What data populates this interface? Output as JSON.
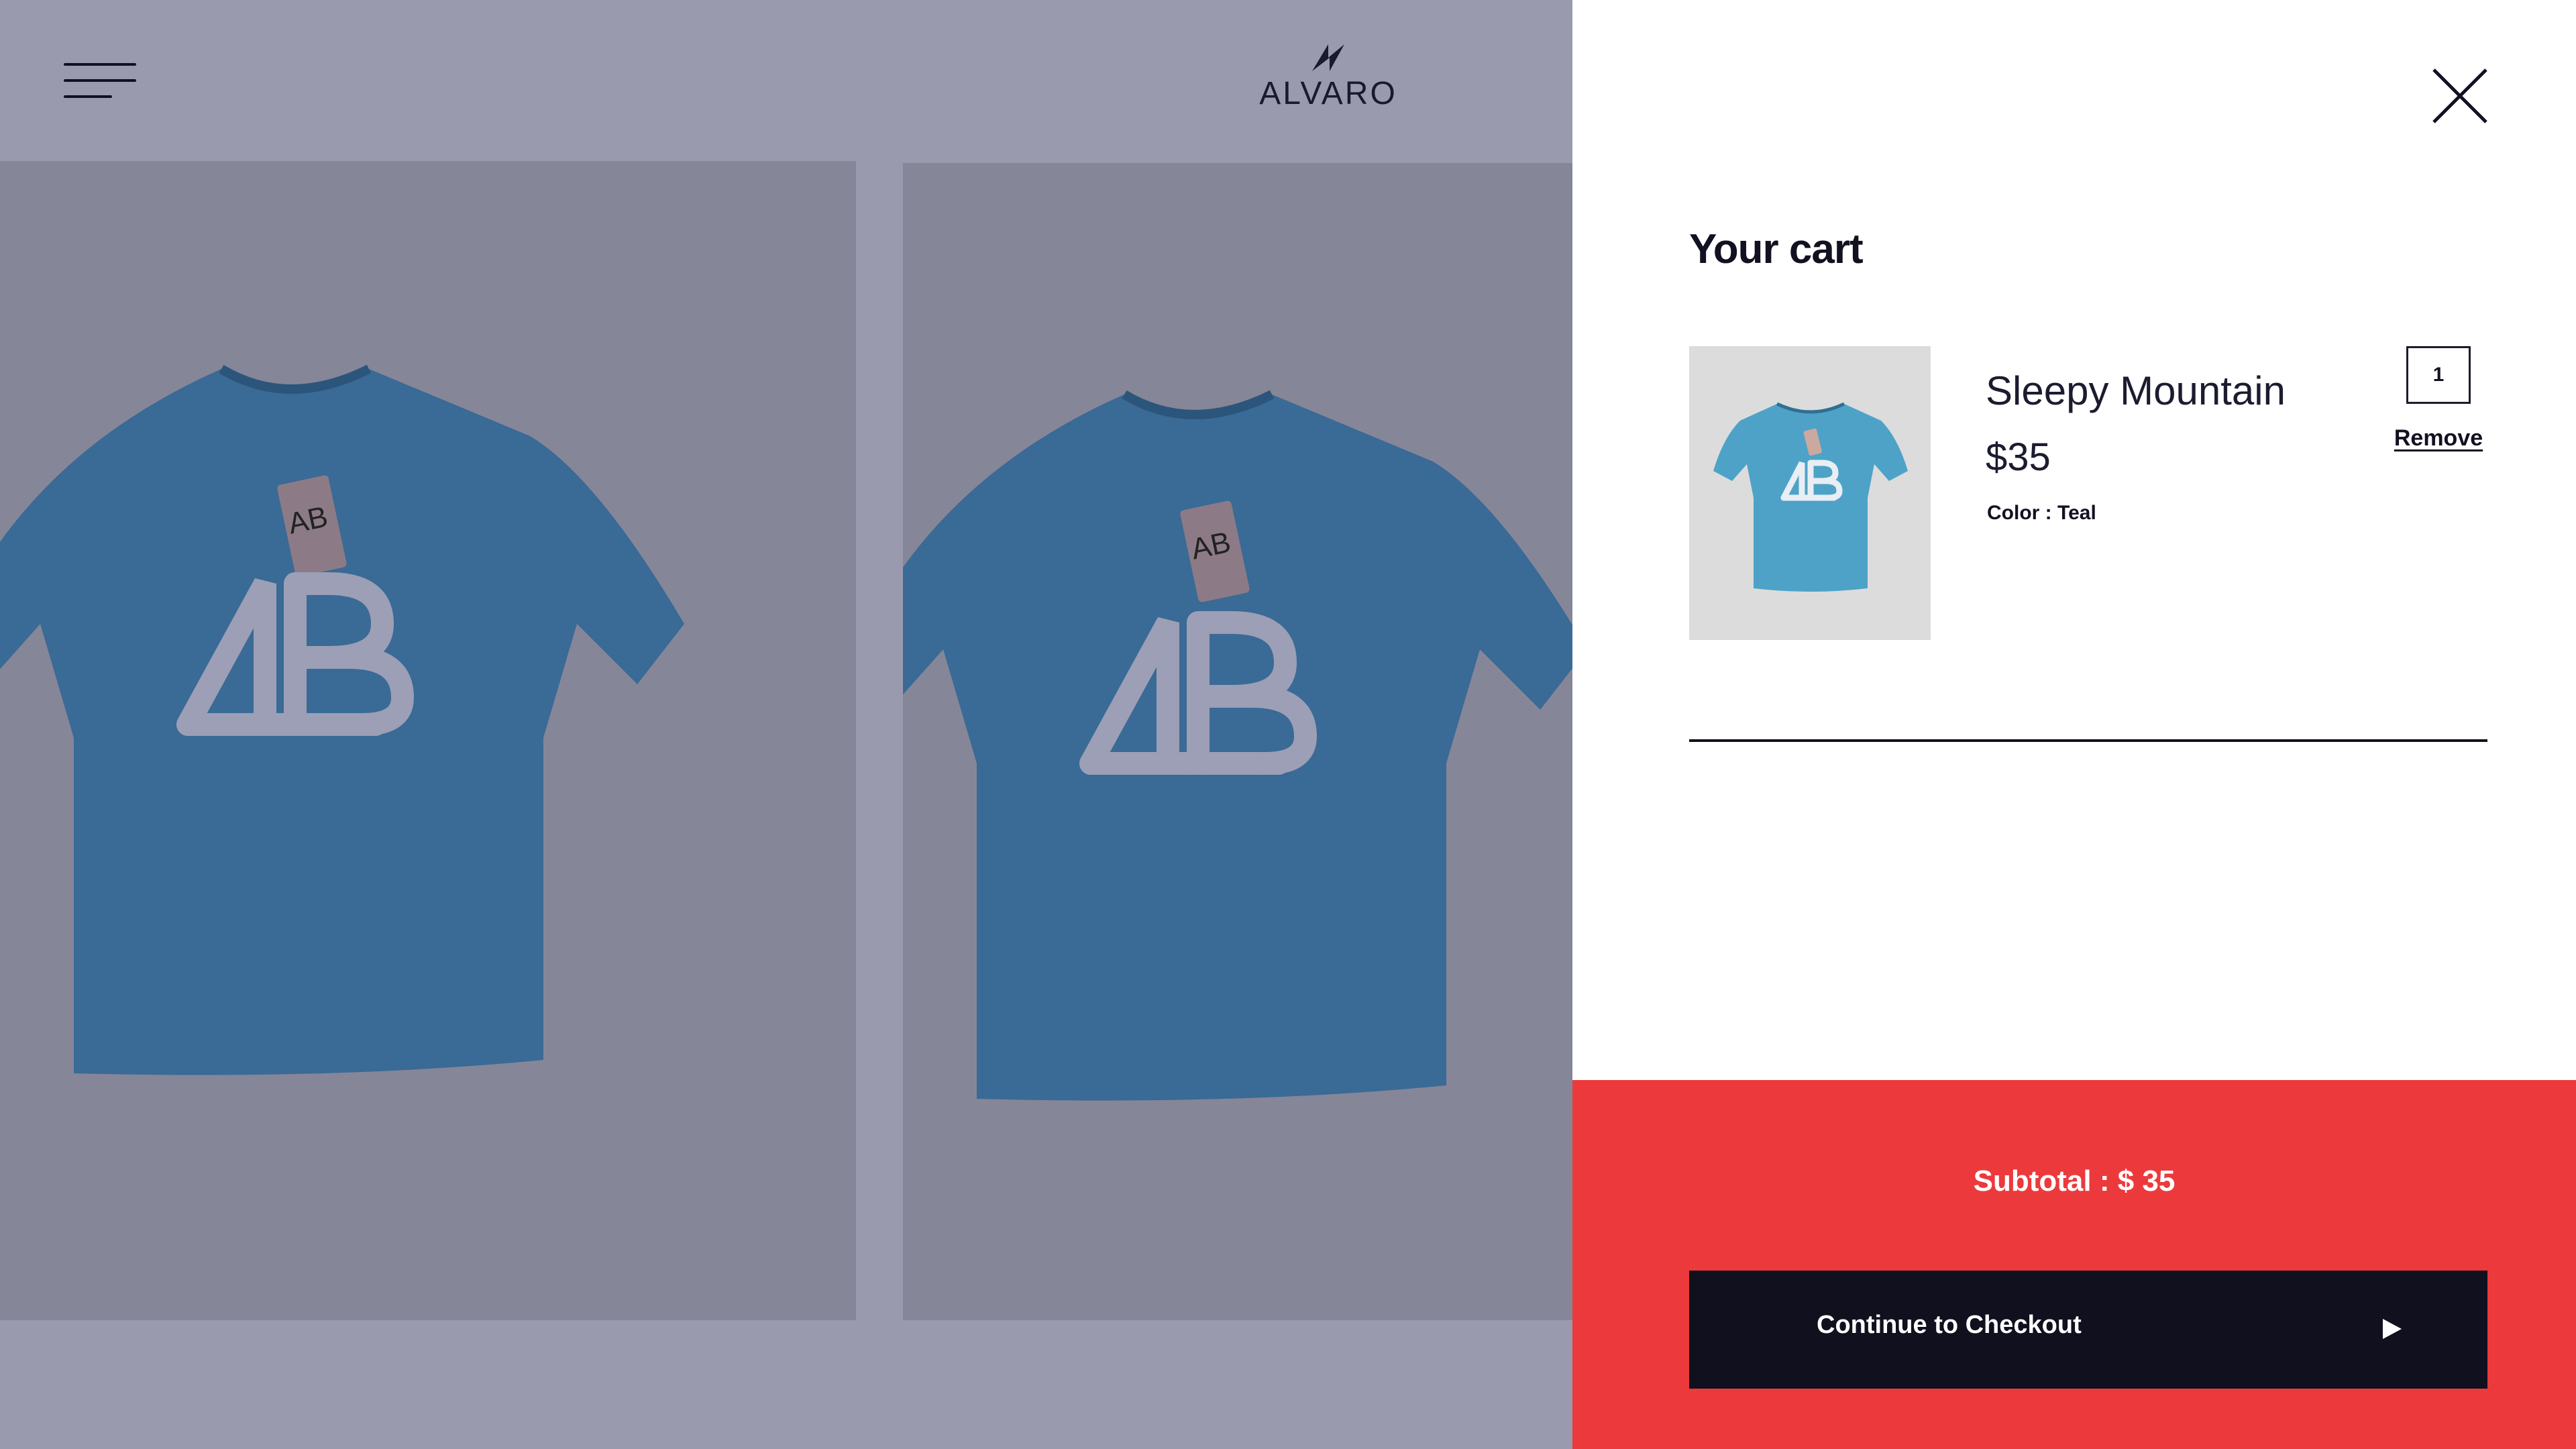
{
  "header": {
    "brand_name": "ALVARO",
    "menu_icon": "hamburger-menu-icon",
    "logo_icon": "lightning-logo-icon"
  },
  "products": [
    {
      "image": "teal-tshirt-mockup",
      "logo_mark": "AB"
    },
    {
      "image": "teal-tshirt-mockup",
      "logo_mark": "AB"
    }
  ],
  "cart": {
    "title": "Your cart",
    "close_icon": "close-icon",
    "items": [
      {
        "name": "Sleepy Mountain",
        "price": "$35",
        "color_label": "Color : Teal",
        "quantity": "1",
        "remove_label": "Remove",
        "image": "teal-tshirt-thumbnail"
      }
    ],
    "subtotal_label": "Subtotal : $ 35",
    "checkout_label": "Continue to Checkout",
    "checkout_icon": "play-arrow-icon"
  },
  "colors": {
    "overlay_bg": "#999aad",
    "card_bg": "#868699",
    "shirt": "#3a6a96",
    "footer_red": "#ec3a3c",
    "button_dark": "#10101e",
    "text_dark": "#111122"
  }
}
